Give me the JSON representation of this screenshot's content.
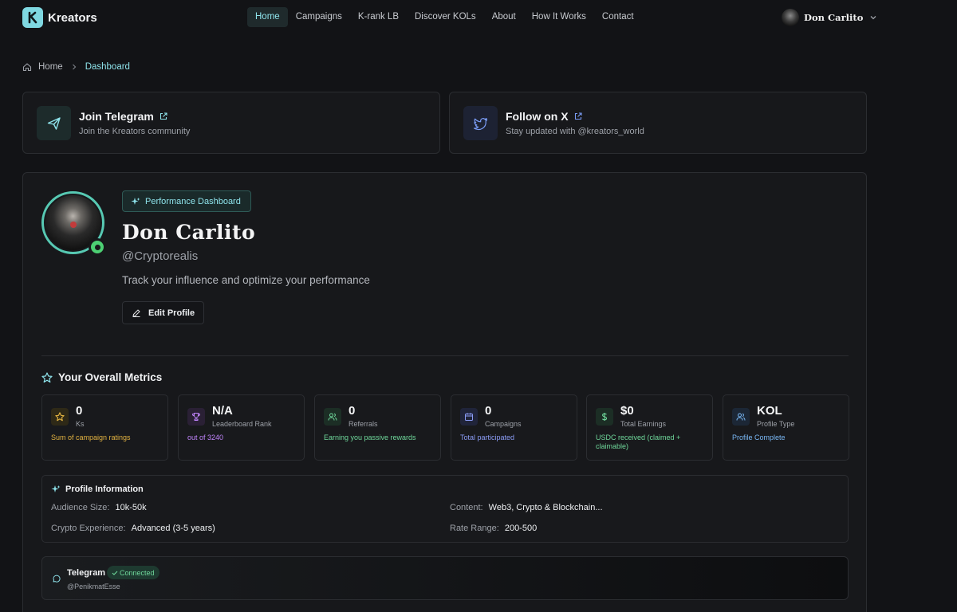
{
  "brand": {
    "logo_letter": "K",
    "name": "Kreators"
  },
  "nav": [
    {
      "label": "Home",
      "active": true
    },
    {
      "label": "Campaigns",
      "active": false
    },
    {
      "label": "K-rank LB",
      "active": false
    },
    {
      "label": "Discover KOLs",
      "active": false
    },
    {
      "label": "About",
      "active": false
    },
    {
      "label": "How It Works",
      "active": false
    },
    {
      "label": "Contact",
      "active": false
    }
  ],
  "user": {
    "name": "Don Carlito"
  },
  "breadcrumb": {
    "home": "Home",
    "current": "Dashboard"
  },
  "social": {
    "telegram": {
      "title": "Join Telegram",
      "subtitle": "Join the Kreators community"
    },
    "x": {
      "title": "Follow on X",
      "subtitle": "Stay updated with @kreators_world"
    }
  },
  "profile": {
    "badge": "Performance Dashboard",
    "name": "Don Carlito",
    "handle": "@Cryptorealis",
    "tagline": "Track your influence and optimize your performance",
    "edit_label": "Edit Profile"
  },
  "metrics_heading": "Your Overall Metrics",
  "metrics": [
    {
      "value": "0",
      "label": "Ks",
      "note": "Sum of campaign ratings",
      "icon": "star-icon",
      "color": "#e3b341",
      "bg": "#2e2917"
    },
    {
      "value": "N/A",
      "label": "Leaderboard Rank",
      "note": "out of 3240",
      "icon": "trophy-icon",
      "color": "#c084fc",
      "bg": "#2a2035"
    },
    {
      "value": "0",
      "label": "Referrals",
      "note": "Earning you passive rewards",
      "icon": "users-icon",
      "color": "#6fd89b",
      "bg": "#1c2e25"
    },
    {
      "value": "0",
      "label": "Campaigns",
      "note": "Total participated",
      "icon": "calendar-icon",
      "color": "#8b9cf6",
      "bg": "#20243a"
    },
    {
      "value": "$0",
      "label": "Total Earnings",
      "note": "USDC received (claimed + claimable)",
      "icon": "dollar-icon",
      "color": "#6fd89b",
      "bg": "#1c2e25"
    },
    {
      "value": "KOL",
      "label": "Profile Type",
      "note": "Profile Complete",
      "icon": "user-icon",
      "color": "#7ab8f5",
      "bg": "#1c2736"
    }
  ],
  "profile_info": {
    "title": "Profile Information",
    "audience_label": "Audience Size:",
    "audience_value": "10k-50k",
    "experience_label": "Crypto Experience:",
    "experience_value": "Advanced (3-5 years)",
    "content_label": "Content:",
    "content_value": "Web3, Crypto & Blockchain...",
    "rate_label": "Rate Range:",
    "rate_value": "200-500"
  },
  "telegram_connection": {
    "title": "Telegram",
    "status": "Connected",
    "handle": "@PenikmatEsse"
  }
}
